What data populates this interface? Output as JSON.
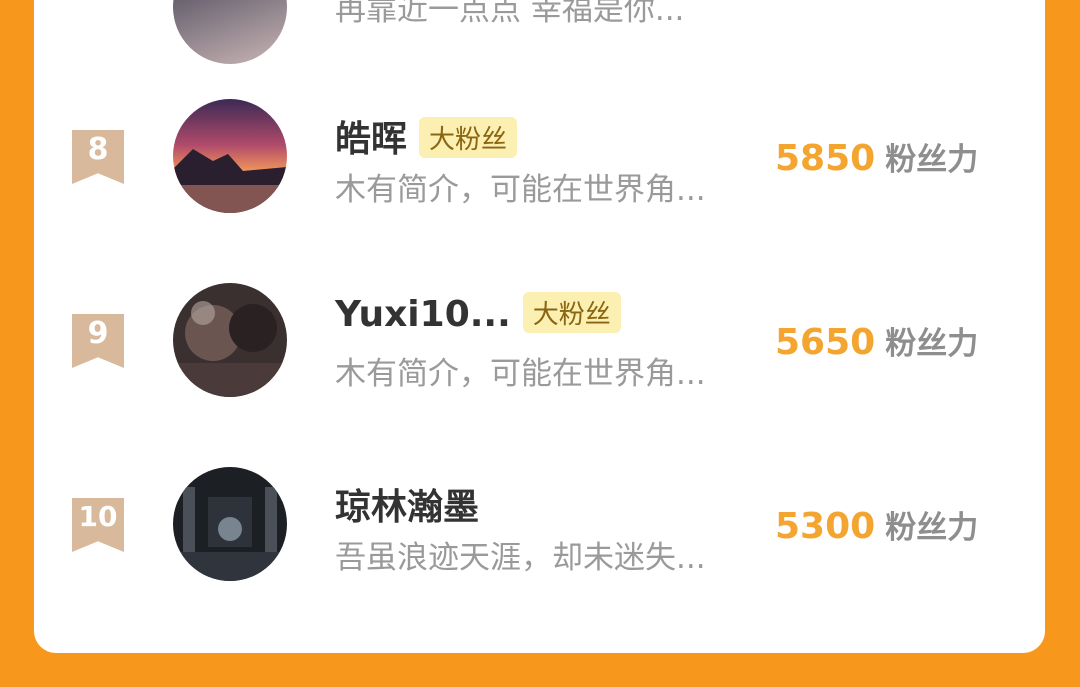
{
  "ranking": [
    {
      "rank": "",
      "name": "",
      "badge": "",
      "bio": "再靠近一点点 幸福是你...",
      "score": "",
      "unit": ""
    },
    {
      "rank": "8",
      "name": "皓晖",
      "badge": "大粉丝",
      "bio": "木有简介，可能在世界角...",
      "score": "5850",
      "unit": "粉丝力"
    },
    {
      "rank": "9",
      "name": "Yuxi10...",
      "badge": "大粉丝",
      "bio": "木有简介，可能在世界角...",
      "score": "5650",
      "unit": "粉丝力"
    },
    {
      "rank": "10",
      "name": "琼林瀚墨",
      "badge": "",
      "bio": "吾虽浪迹天涯，却未迷失...",
      "score": "5300",
      "unit": "粉丝力"
    }
  ],
  "colors": {
    "background": "#f7981d",
    "card": "#ffffff",
    "rank_ribbon": "#d9b99b",
    "score": "#f4a530",
    "badge_bg": "#fbefb1"
  }
}
